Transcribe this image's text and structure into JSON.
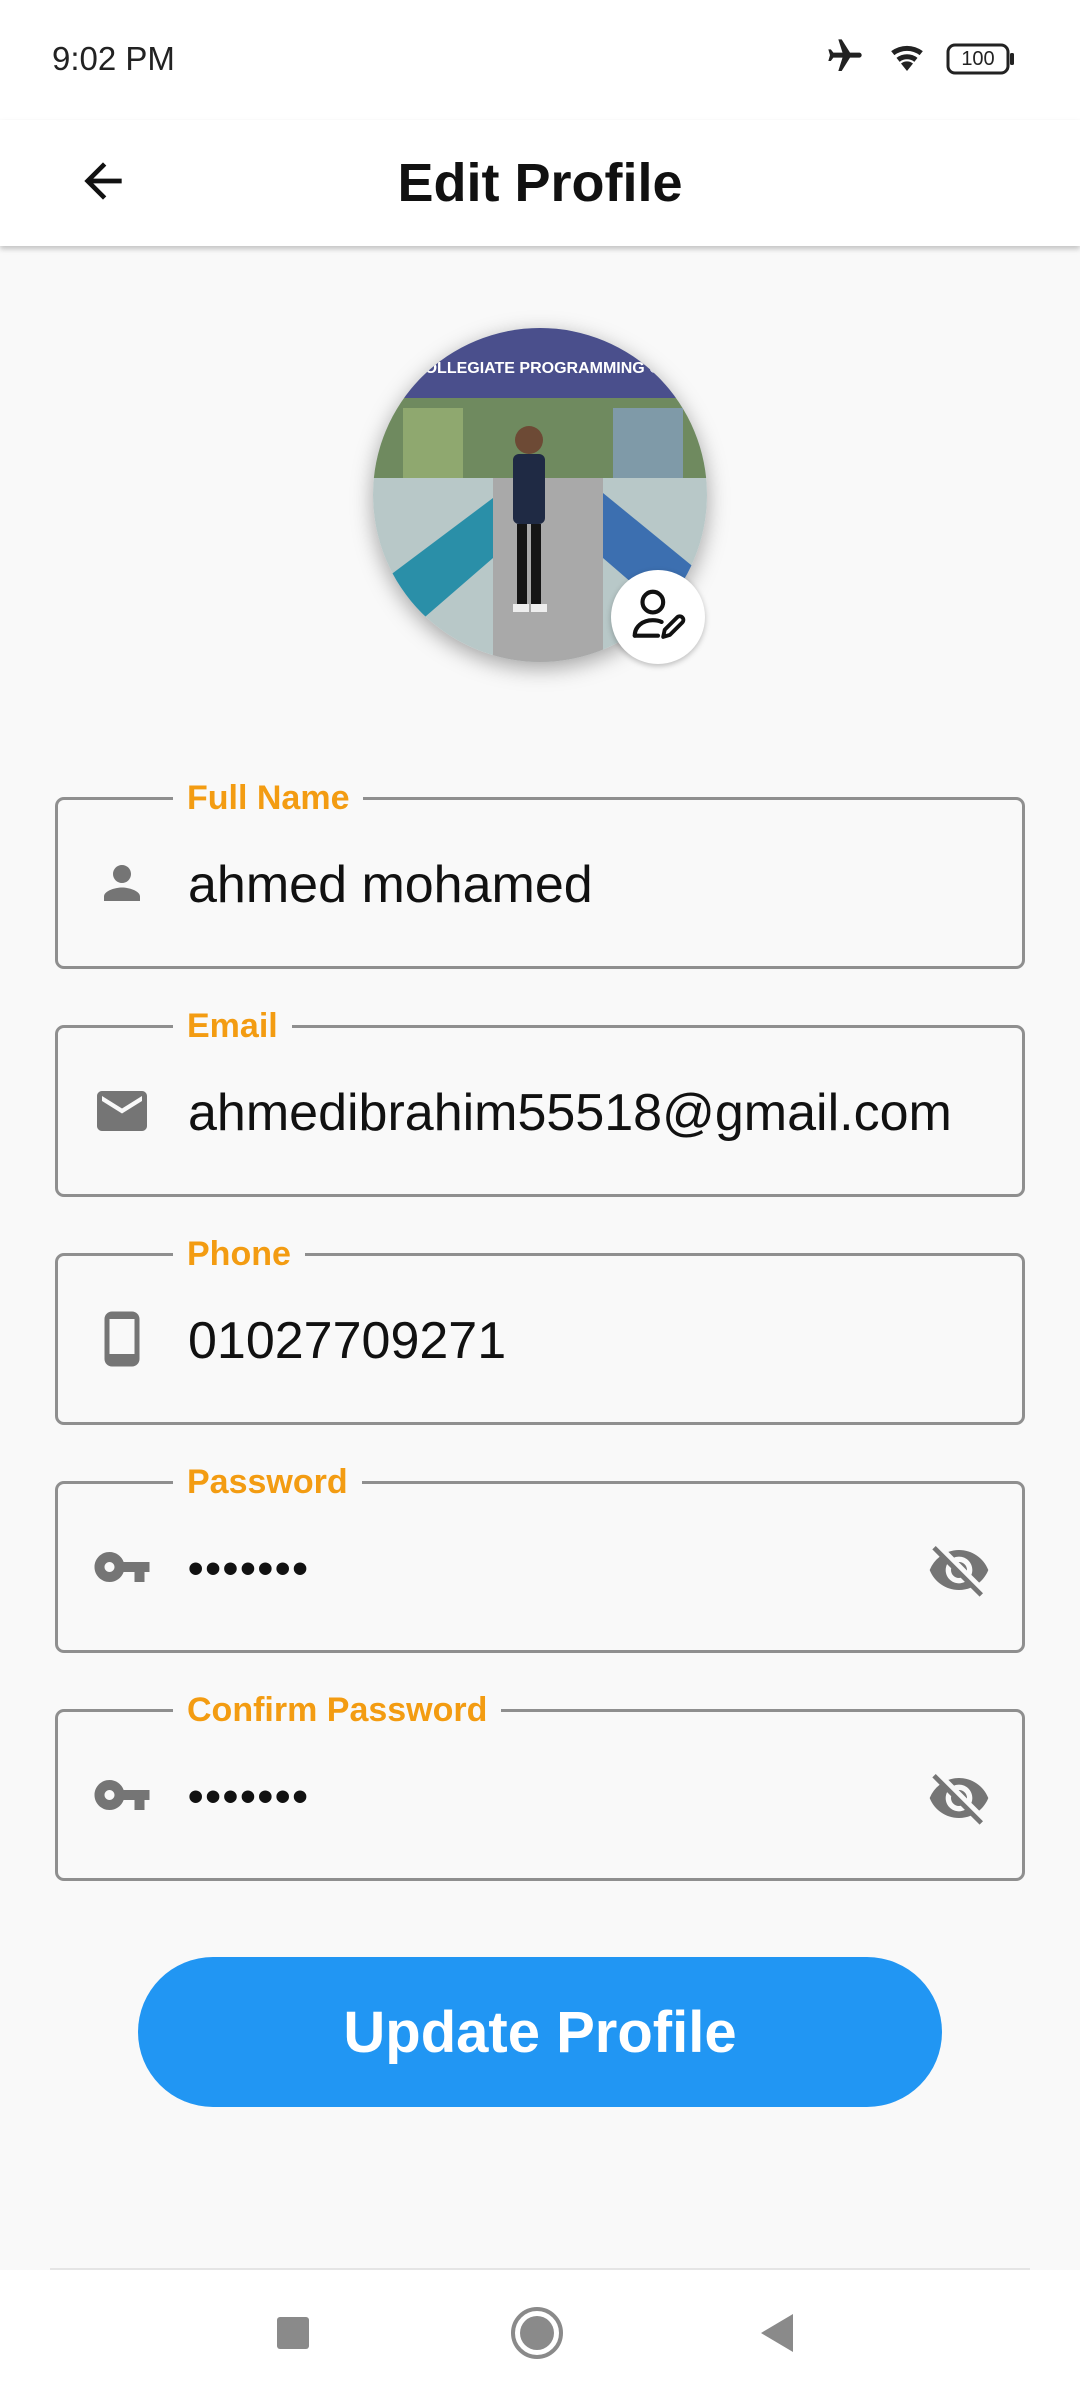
{
  "status_bar": {
    "time": "9:02 PM",
    "battery": "100",
    "icons": [
      "airplane-icon",
      "wifi-icon",
      "battery-icon"
    ]
  },
  "app_bar": {
    "title": "Edit Profile",
    "back_icon": "arrow-back-icon"
  },
  "avatar": {
    "banner_text": "AN COLLEGIATE PROGRAMMING CONT",
    "edit_icon": "user-edit-icon"
  },
  "form": {
    "full_name": {
      "label": "Full Name",
      "value": "ahmed mohamed",
      "icon": "person-icon"
    },
    "email": {
      "label": "Email",
      "value": "ahmedibrahim55518@gmail.com",
      "icon": "mail-icon"
    },
    "phone": {
      "label": "Phone",
      "value": "01027709271",
      "icon": "phone-icon"
    },
    "password": {
      "label": "Password",
      "value": "•••••••",
      "icon": "key-icon",
      "trailing_icon": "visibility-off-icon"
    },
    "confirm_password": {
      "label": "Confirm Password",
      "value": "•••••••",
      "icon": "key-icon",
      "trailing_icon": "visibility-off-icon"
    }
  },
  "actions": {
    "update_label": "Update Profile"
  },
  "nav_bar": {
    "items": [
      "recents-square-icon",
      "home-circle-icon",
      "back-triangle-icon"
    ]
  },
  "colors": {
    "accent_label": "#f39c12",
    "primary_button": "#2196f3",
    "border": "#8f8f8f",
    "background": "#f9f9f9"
  }
}
